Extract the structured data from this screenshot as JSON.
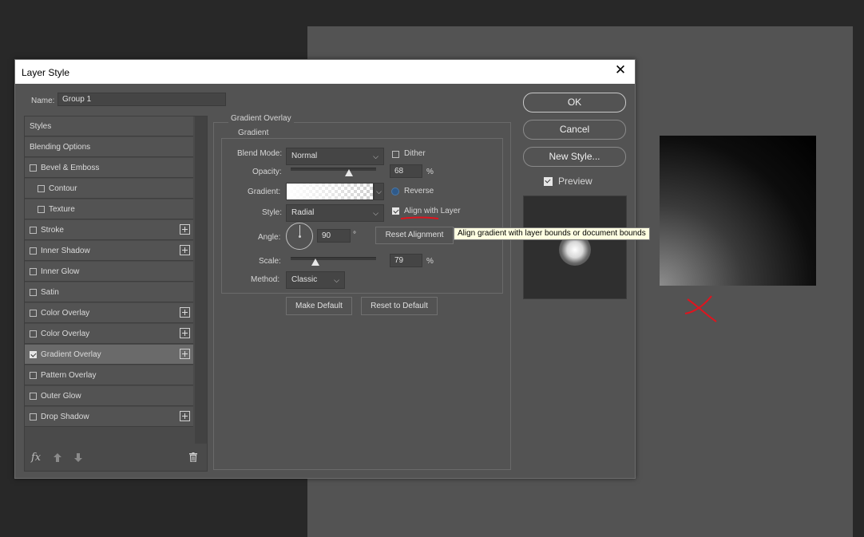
{
  "dialog": {
    "title": "Layer Style"
  },
  "name_field": {
    "label": "Name:",
    "value": "Group 1"
  },
  "styles": [
    {
      "label": "Styles",
      "checkbox": false,
      "checked": false,
      "plus": false,
      "indent": 0,
      "selected": false
    },
    {
      "label": "Blending Options",
      "checkbox": false,
      "checked": false,
      "plus": false,
      "indent": 0,
      "selected": false
    },
    {
      "label": "Bevel & Emboss",
      "checkbox": true,
      "checked": false,
      "plus": false,
      "indent": 0,
      "selected": false
    },
    {
      "label": "Contour",
      "checkbox": true,
      "checked": false,
      "plus": false,
      "indent": 1,
      "selected": false
    },
    {
      "label": "Texture",
      "checkbox": true,
      "checked": false,
      "plus": false,
      "indent": 1,
      "selected": false
    },
    {
      "label": "Stroke",
      "checkbox": true,
      "checked": false,
      "plus": true,
      "indent": 0,
      "selected": false
    },
    {
      "label": "Inner Shadow",
      "checkbox": true,
      "checked": false,
      "plus": true,
      "indent": 0,
      "selected": false
    },
    {
      "label": "Inner Glow",
      "checkbox": true,
      "checked": false,
      "plus": false,
      "indent": 0,
      "selected": false
    },
    {
      "label": "Satin",
      "checkbox": true,
      "checked": false,
      "plus": false,
      "indent": 0,
      "selected": false
    },
    {
      "label": "Color Overlay",
      "checkbox": true,
      "checked": false,
      "plus": true,
      "indent": 0,
      "selected": false
    },
    {
      "label": "Color Overlay",
      "checkbox": true,
      "checked": false,
      "plus": true,
      "indent": 0,
      "selected": false
    },
    {
      "label": "Gradient Overlay",
      "checkbox": true,
      "checked": true,
      "plus": true,
      "indent": 0,
      "selected": true
    },
    {
      "label": "Pattern Overlay",
      "checkbox": true,
      "checked": false,
      "plus": false,
      "indent": 0,
      "selected": false
    },
    {
      "label": "Outer Glow",
      "checkbox": true,
      "checked": false,
      "plus": false,
      "indent": 0,
      "selected": false
    },
    {
      "label": "Drop Shadow",
      "checkbox": true,
      "checked": false,
      "plus": true,
      "indent": 0,
      "selected": false
    }
  ],
  "footer_icons": {
    "fx": "fx",
    "up": "arrow-up-icon",
    "down": "arrow-down-icon",
    "trash": "trash-icon"
  },
  "gradient_overlay": {
    "section_title": "Gradient Overlay",
    "group_title": "Gradient",
    "blend_mode_label": "Blend Mode:",
    "blend_mode_value": "Normal",
    "dither_label": "Dither",
    "dither_checked": false,
    "opacity_label": "Opacity:",
    "opacity_value": "68",
    "opacity_fraction": 0.68,
    "percent": "%",
    "gradient_label": "Gradient:",
    "reverse_label": "Reverse",
    "style_label": "Style:",
    "style_value": "Radial",
    "align_label": "Align with Layer",
    "align_checked": true,
    "angle_label": "Angle:",
    "angle_value": "90",
    "degree": "°",
    "reset_alignment": "Reset Alignment",
    "scale_label": "Scale:",
    "scale_value": "79",
    "scale_fraction": 0.79,
    "method_label": "Method:",
    "method_value": "Classic",
    "make_default": "Make Default",
    "reset_default": "Reset to Default"
  },
  "tooltip": "Align gradient with layer bounds or document bounds",
  "right_buttons": {
    "ok": "OK",
    "cancel": "Cancel",
    "new_style": "New Style..."
  },
  "preview": {
    "label": "Preview",
    "checked": true
  },
  "colors": {
    "annotation_red": "#e0141e",
    "dialog_bg": "#535353",
    "selected_row": "#6a6a6a"
  }
}
